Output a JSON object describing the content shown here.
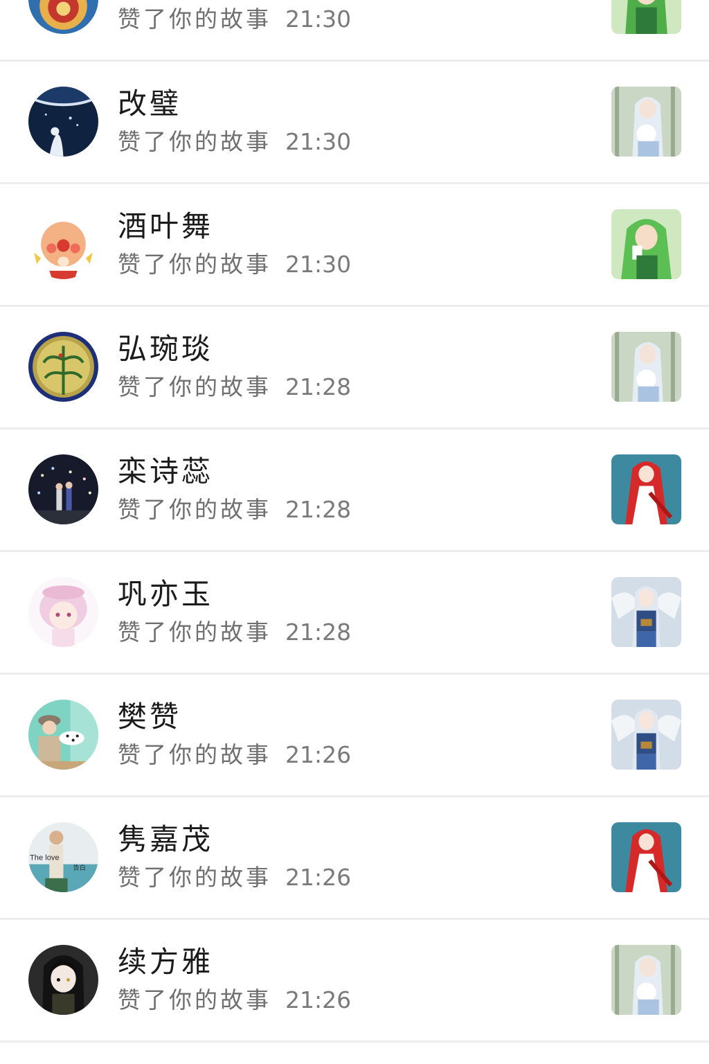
{
  "notifications": [
    {
      "name": "",
      "action": "赞了你的故事",
      "time": "21:30",
      "avatar": "festive-red-blue-avatar",
      "story_thumb": "green-hair-anime-girl"
    },
    {
      "name": "改璧",
      "action": "赞了你的故事",
      "time": "21:30",
      "avatar": "night-sky-moon-avatar",
      "story_thumb": "silver-hair-bouquet-girl"
    },
    {
      "name": "酒叶舞",
      "action": "赞了你的故事",
      "time": "21:30",
      "avatar": "cartoon-clown-avatar",
      "story_thumb": "green-hair-anime-girl"
    },
    {
      "name": "弘琬琰",
      "action": "赞了你的故事",
      "time": "21:28",
      "avatar": "gold-coin-plant-avatar",
      "story_thumb": "silver-hair-bouquet-girl"
    },
    {
      "name": "栾诗蕊",
      "action": "赞了你的故事",
      "time": "21:28",
      "avatar": "night-lights-couple-avatar",
      "story_thumb": "red-white-dress-girl"
    },
    {
      "name": "巩亦玉",
      "action": "赞了你的故事",
      "time": "21:28",
      "avatar": "pink-anime-girl-avatar",
      "story_thumb": "blue-armor-winged-girl"
    },
    {
      "name": "樊赞",
      "action": "赞了你的故事",
      "time": "21:26",
      "avatar": "boy-with-dalmatian-avatar",
      "story_thumb": "blue-armor-winged-girl"
    },
    {
      "name": "隽嘉茂",
      "action": "赞了你的故事",
      "time": "21:26",
      "avatar": "the-love-photo-avatar",
      "avatar_text": "The love",
      "avatar_text2": "告白",
      "story_thumb": "red-white-dress-girl"
    },
    {
      "name": "续方雅",
      "action": "赞了你的故事",
      "time": "21:26",
      "avatar": "dark-hair-anime-boy-avatar",
      "story_thumb": "silver-hair-bouquet-girl"
    }
  ],
  "colors": {
    "divider": "#ececec",
    "name_text": "#1b1b1b",
    "meta_text": "#6f6f6f"
  }
}
